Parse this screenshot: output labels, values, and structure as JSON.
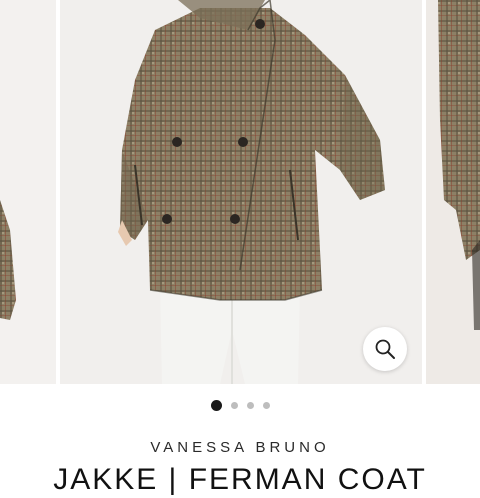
{
  "gallery": {
    "slide_count": 4,
    "active_index": 0,
    "fabric_pattern": "houndstooth-check",
    "colors": {
      "fabric": "#8a7d63",
      "fabric_dark": "#3f3a2e",
      "check_red": "#8a3b2a",
      "trousers": "#f4f4f2",
      "button": "#2b2622"
    }
  },
  "zoom": {
    "icon": "magnifier-icon"
  },
  "product": {
    "brand": "VANESSA BRUNO",
    "title": "JAKKE | FERMAN COAT"
  }
}
